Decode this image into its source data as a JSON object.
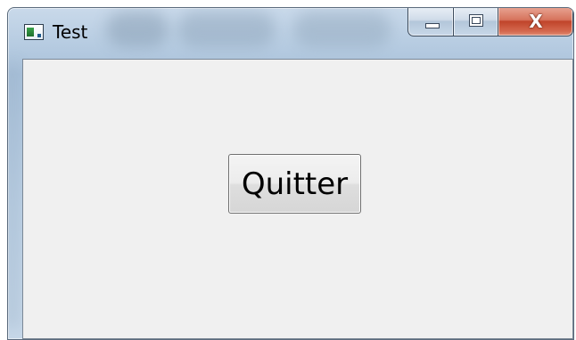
{
  "window": {
    "title": "Test",
    "icon": "application-window-icon",
    "caption_buttons": {
      "minimize_icon": "minimize-icon",
      "maximize_icon": "maximize-icon",
      "close_icon": "close-icon",
      "close_glyph": "X"
    }
  },
  "main": {
    "quit_button_label": "Quitter"
  },
  "colors": {
    "client_background": "#f0f0f0",
    "close_button": "#c8432b",
    "frame": "#b8cde2"
  }
}
